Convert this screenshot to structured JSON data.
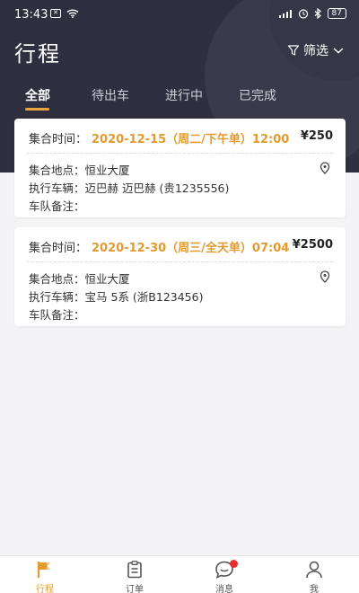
{
  "status": {
    "time": "13:43",
    "battery": "87"
  },
  "header": {
    "title": "行程",
    "filter_label": "筛选"
  },
  "tabs": [
    {
      "label": "全部",
      "active": true
    },
    {
      "label": "待出车"
    },
    {
      "label": "进行中"
    },
    {
      "label": "已完成"
    }
  ],
  "trips": [
    {
      "time_label": "集合时间：",
      "time_value": "2020-12-15（周二/下午单）12:00",
      "price": "¥250",
      "location_label": "集合地点：",
      "location": "恒业大厦",
      "vehicle_label": "执行车辆：",
      "vehicle": "迈巴赫 迈巴赫 (贵1235556)",
      "note_label": "车队备注：",
      "note": ""
    },
    {
      "time_label": "集合时间：",
      "time_value": "2020-12-30（周三/全天单）07:04",
      "price": "¥2500",
      "location_label": "集合地点：",
      "location": "恒业大厦",
      "vehicle_label": "执行车辆：",
      "vehicle": "宝马 5系 (浙B123456)",
      "note_label": "车队备注：",
      "note": ""
    }
  ],
  "tabbar": [
    {
      "label": "行程",
      "active": true
    },
    {
      "label": "订单"
    },
    {
      "label": "消息"
    },
    {
      "label": "我"
    }
  ],
  "colors": {
    "accent": "#e39b2f",
    "header_bg": "#2f2f3f",
    "badge": "#e62e2e"
  }
}
